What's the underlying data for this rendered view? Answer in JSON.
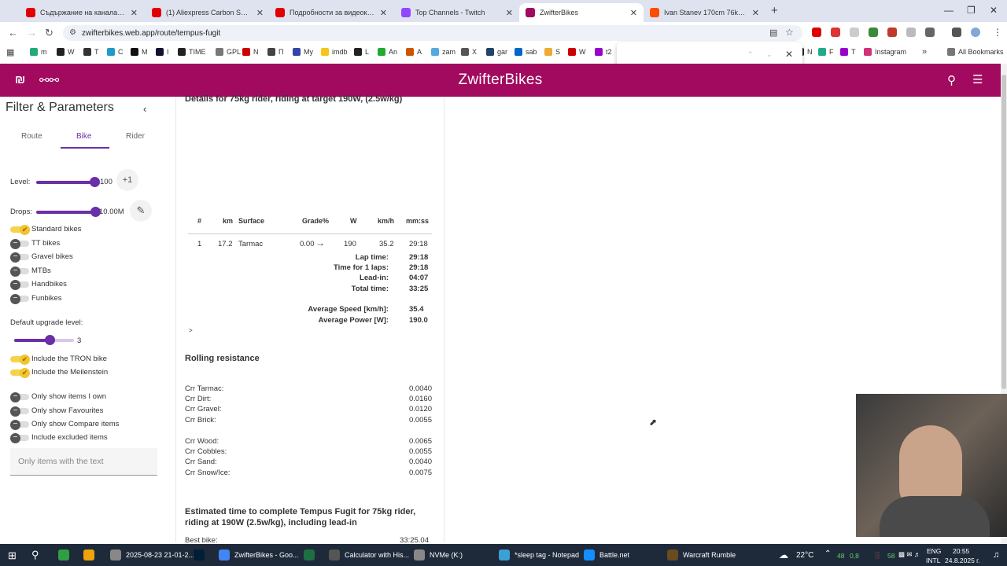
{
  "browser": {
    "tabs": [
      {
        "title": "Съдържание на канала - YouTube",
        "favicon_color": "#e00000"
      },
      {
        "title": "(1) Aliexpress Carbon Saddle Ki",
        "favicon_color": "#e00000"
      },
      {
        "title": "Подробности за видеоклипа",
        "favicon_color": "#e00000"
      },
      {
        "title": "Top Channels - Twitch",
        "favicon_color": "#9146ff"
      },
      {
        "title": "ZwifterBikes",
        "favicon_color": "#a10a5e"
      },
      {
        "title": "Ivan Stanev 170cm 76kg | Strava",
        "favicon_color": "#fc4c02"
      }
    ],
    "url": "zwifterbikes.web.app/route/tempus-fugit",
    "bookmarks": [
      "m",
      "W",
      "T",
      "C",
      "M",
      "I",
      "TIME",
      "GPL",
      "N",
      "П",
      "My",
      "imdb",
      "L",
      "An",
      "A",
      "zam",
      "X",
      "gar",
      "sab",
      "S",
      "W",
      "t2"
    ],
    "bookmarks_right": [
      "N",
      "F",
      "T",
      "Instagram"
    ],
    "all_bookmarks": "All Bookmarks"
  },
  "app": {
    "brand": "ZwifterBikes",
    "accent": "#a10a5e",
    "slider_color": "#6b2fa8"
  },
  "sidebar": {
    "title": "Filter & Parameters",
    "tabs": [
      "Route",
      "Bike",
      "Rider"
    ],
    "active_tab": "Bike",
    "level_label": "Level:",
    "level_value": "100",
    "level_plus": "+1",
    "drops_label": "Drops:",
    "drops_value": "10.00M",
    "bike_types": [
      {
        "label": "Standard bikes",
        "on": true
      },
      {
        "label": "TT bikes",
        "on": false
      },
      {
        "label": "Gravel bikes",
        "on": false
      },
      {
        "label": "MTBs",
        "on": false
      },
      {
        "label": "Handbikes",
        "on": false
      },
      {
        "label": "Funbikes",
        "on": false
      }
    ],
    "upgrade_label": "Default upgrade level:",
    "upgrade_value": "3",
    "include": [
      {
        "label": "Include the TRON bike",
        "on": true
      },
      {
        "label": "Include the Meilenstein",
        "on": true
      }
    ],
    "filters": [
      {
        "label": "Only show items I own",
        "on": false
      },
      {
        "label": "Only show Favourites",
        "on": false
      },
      {
        "label": "Only show Compare items",
        "on": false
      },
      {
        "label": "Include excluded items",
        "on": false
      }
    ],
    "text_filter_placeholder": "Only items with the text"
  },
  "main": {
    "details_title": "Details for 75kg rider, riding at target 190W, (2.5w/kg)",
    "table": {
      "headers": [
        "#",
        "km",
        "Surface",
        "Grade%",
        "W",
        "km/h",
        "mm:ss"
      ],
      "rows": [
        {
          "n": "1",
          "km": "17.2",
          "surface": "Tarmac",
          "grade": "0.00",
          "w": "190",
          "kmh": "35.2",
          "time": "29:18"
        }
      ]
    },
    "summary": [
      {
        "label": "Lap time:",
        "value": "29:18"
      },
      {
        "label": "Time for 1 laps:",
        "value": "29:18"
      },
      {
        "label": "Lead-in:",
        "value": "04:07"
      },
      {
        "label": "Total time:",
        "value": "33:25"
      }
    ],
    "averages": [
      {
        "label": "Average Speed [km/h]:",
        "value": "35.4"
      },
      {
        "label": "Average Power [W]:",
        "value": "190.0"
      }
    ],
    "expand": ">",
    "rolling_title": "Rolling resistance",
    "crr_group1": [
      {
        "label": "Crr Tarmac:",
        "value": "0.0040"
      },
      {
        "label": "Crr Dirt:",
        "value": "0.0160"
      },
      {
        "label": "Crr Gravel:",
        "value": "0.0120"
      },
      {
        "label": "Crr Brick:",
        "value": "0.0055"
      }
    ],
    "crr_group2": [
      {
        "label": "Crr Wood:",
        "value": "0.0065"
      },
      {
        "label": "Crr Cobbles:",
        "value": "0.0055"
      },
      {
        "label": "Crr Sand:",
        "value": "0.0040"
      },
      {
        "label": "Crr Snow/Ice:",
        "value": "0.0075"
      }
    ],
    "estimate_title": "Estimated time to complete Tempus Fugit for 75kg rider, riding at 190W (2.5w/kg), including lead-in",
    "best_bike_label": "Best bike:",
    "best_bike_value": "33:25.04"
  },
  "taskbar": {
    "items": [
      {
        "label": "",
        "color": "#2ea043"
      },
      {
        "label": "",
        "color": "#f0a30a"
      },
      {
        "label": "2025-08-23 21-01-2...",
        "color": "#888"
      },
      {
        "label": "",
        "color": "#001e36"
      },
      {
        "label": "ZwifterBikes - Goo...",
        "color": "#4285f4"
      },
      {
        "label": "",
        "color": "#1d6f42"
      },
      {
        "label": "Calculator with His...",
        "color": "#555"
      },
      {
        "label": "NVMe (K:)",
        "color": "#888"
      },
      {
        "label": "*sleep tag - Notepad",
        "color": "#3aa0d8"
      },
      {
        "label": "Battle.net",
        "color": "#148eff"
      },
      {
        "label": "Warcraft Rumble",
        "color": "#6b4a1e"
      }
    ],
    "weather": "22°C",
    "tray_a": "48",
    "tray_b": "0,8",
    "tray_c": "58",
    "lang1": "ENG",
    "lang2": "INTL",
    "time": "20:55",
    "date": "24.8.2025 г."
  }
}
